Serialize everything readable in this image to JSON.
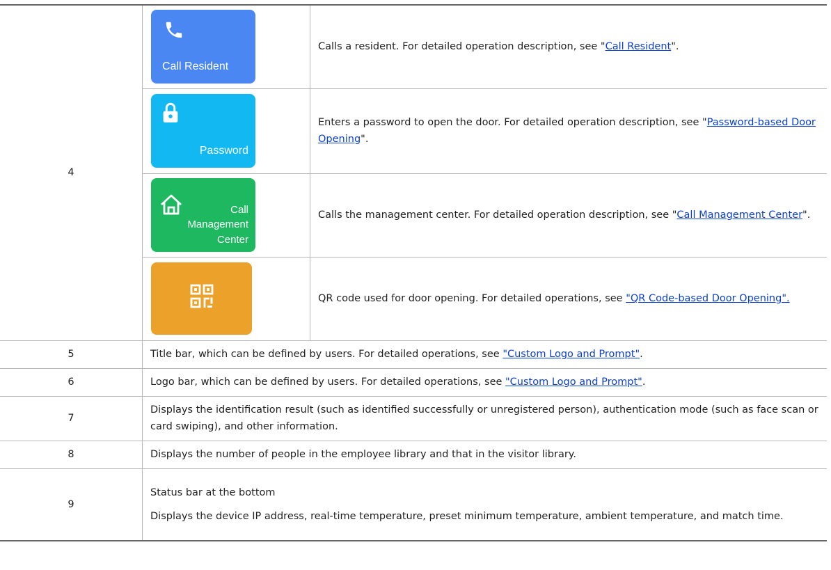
{
  "rows": [
    {
      "number": "4",
      "sub": [
        {
          "tile_label": "Call Resident",
          "icon": "phone-icon",
          "color": "#4a87f3",
          "text": "Calls a resident. For detailed operation description, see \"",
          "link": "Call Resident",
          "tail": "\"."
        },
        {
          "tile_label": "Password",
          "icon": "lock-icon",
          "color": "#12b8f1",
          "text": "Enters a password to open the door. For detailed operation description, see \"",
          "link": "Password-based Door Opening",
          "tail": "\"."
        },
        {
          "tile_label_line1": "Call",
          "tile_label_line2": "Management",
          "tile_label_line3": "Center",
          "icon": "home-icon",
          "color": "#1eb860",
          "text": "Calls the management center. For detailed operation description, see \"",
          "link": "Call Management Center",
          "tail": "\"."
        },
        {
          "icon": "qr-code-icon",
          "color": "#eba12a",
          "text": "QR code used for door opening. For detailed operations, see ",
          "link": "\"QR Code-based Door Opening\".",
          "tail": ""
        }
      ]
    },
    {
      "number": "5",
      "text": "Title bar, which can be defined by users. For detailed operations, see ",
      "link": "\"Custom Logo and Prompt\"",
      "tail": "."
    },
    {
      "number": "6",
      "text": "Logo bar, which can be defined by users. For detailed operations, see ",
      "link": "\"Custom Logo and Prompt\"",
      "tail": "."
    },
    {
      "number": "7",
      "text": "Displays the identification result (such as identified successfully or unregistered person), authentication mode (such as face scan or card swiping), and other information."
    },
    {
      "number": "8",
      "text": "Displays the number of people in the employee library and that in the visitor library."
    },
    {
      "number": "9",
      "line1": "Status bar at the bottom",
      "line2": "Displays the device IP address, real-time temperature, preset minimum temperature, ambient temperature, and match time."
    }
  ]
}
